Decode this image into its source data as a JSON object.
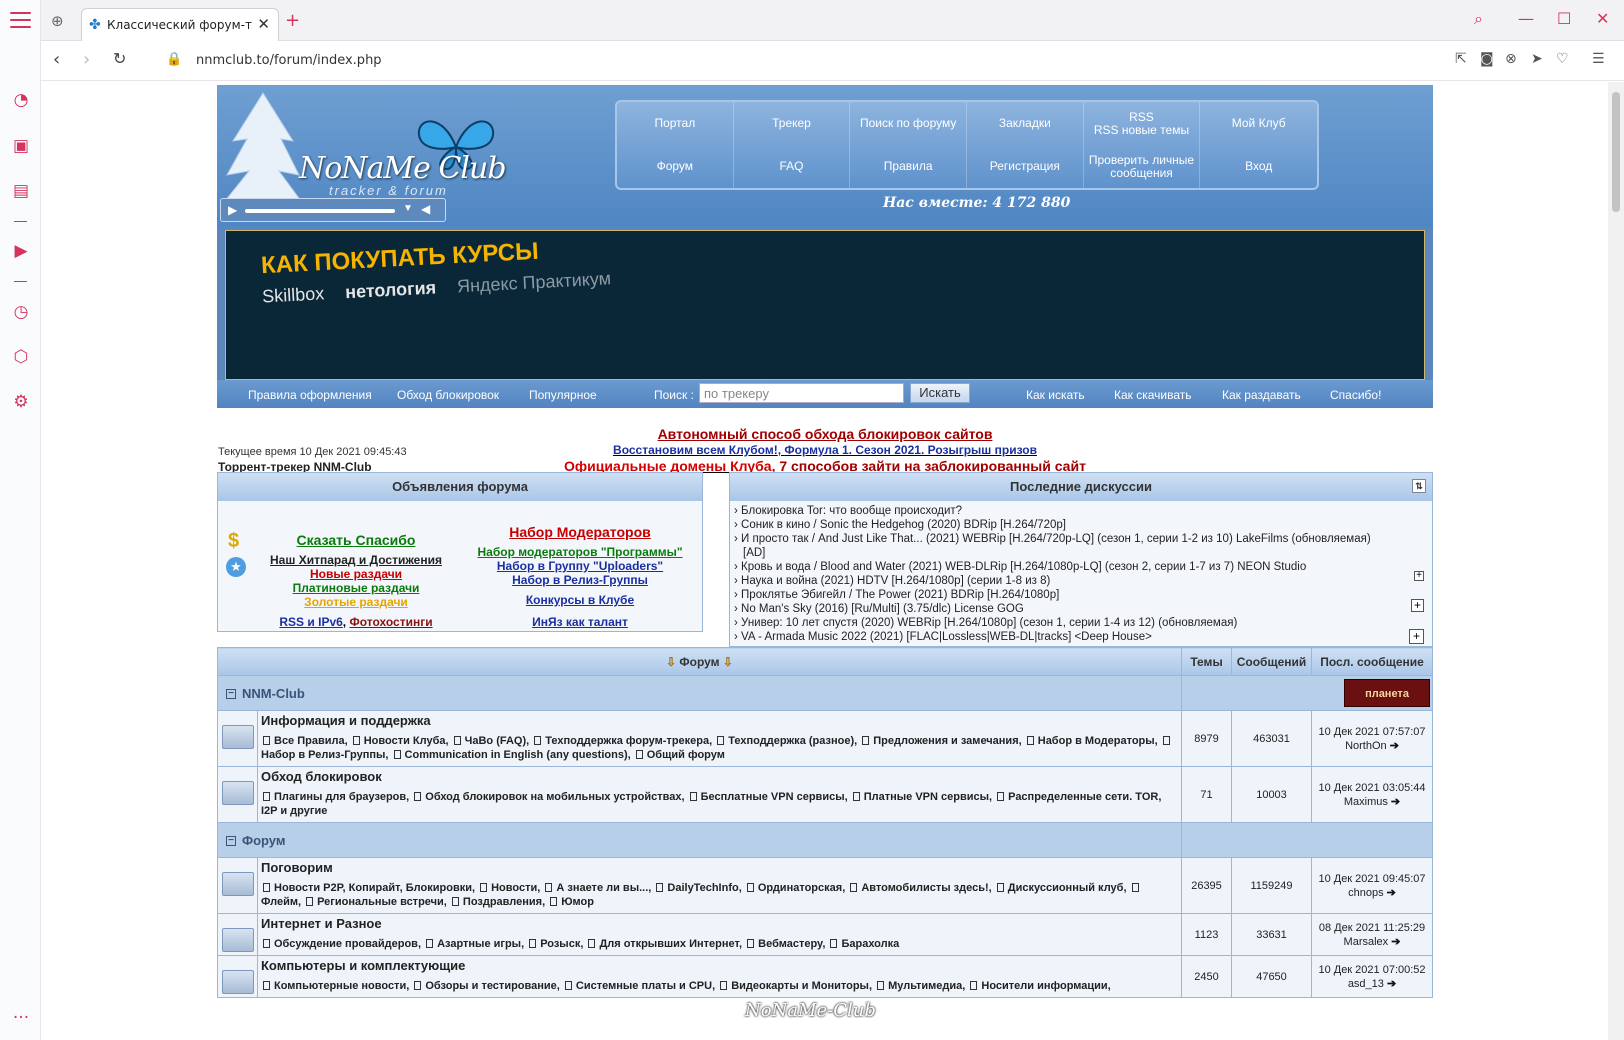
{
  "browser": {
    "tab_title": "Классический форум-трекер",
    "url": "nnmclub.to/forum/index.php"
  },
  "header": {
    "logo": "NoNaMe Club",
    "logo_sub": "tracker & forum",
    "together": "Нас вместе: 4 172 880",
    "nav": [
      "Портал",
      "Трекер",
      "Поиск по форуму",
      "Закладки",
      "RSS\nRSS новые темы",
      "Мой Клуб",
      "Форум",
      "FAQ",
      "Правила",
      "Регистрация",
      "Проверить личные сообщения",
      "Вход"
    ]
  },
  "banner": {
    "headline": "КАК ПОКУПАТЬ КУРСЫ",
    "brands": [
      "Skillbox",
      "нетология",
      "Яндекс Практикум"
    ]
  },
  "toolbar": {
    "left": [
      "Правила оформления",
      "Обход блокировок",
      "Популярное"
    ],
    "search_label": "Поиск :",
    "search_placeholder": "по трекеру",
    "search_button": "Искать",
    "right": [
      "Как искать",
      "Как скачивать",
      "Как раздавать",
      "Спасибо!"
    ]
  },
  "info": {
    "current_time": "Текущее время 10 Дек 2021 09:45:43",
    "tracker_title": "Торрент-трекер NNM-Club",
    "announce_1": "Автономный способ обхода блокировок сайтов",
    "announce_2a": "Восстановим всем Клубом!",
    "announce_2b": "Формула 1. Сезон 2021. Розыгрыш призов",
    "announce_3a": "Официальные домены Клуба",
    "announce_3b": "7 способов зайти на заблокированный сайт"
  },
  "announcements": {
    "title": "Объявления форума",
    "left": [
      {
        "text": "Сказать Спасибо",
        "color": "#0a7a0a",
        "size": 14
      },
      {
        "text": "Наш Хитпарад и Достижения",
        "color": "#222222",
        "size": 12
      },
      {
        "text": "Новые раздачи",
        "color": "#c40000",
        "size": 12
      },
      {
        "text": "Платиновые раздачи",
        "color": "#0a7a0a",
        "size": 12
      },
      {
        "text": "Золотые раздачи",
        "color": "#e6a400",
        "size": 12
      }
    ],
    "left_bottom_a": "RSS и IPv6",
    "left_bottom_b": "Фотохостинги",
    "right": [
      {
        "text": "Набор Модераторов",
        "color": "#c40000",
        "size": 14
      },
      {
        "text": "Набор модераторов \"Программы\"",
        "color": "#0a7a0a",
        "size": 12
      },
      {
        "text": "Набор в Группу \"Uploaders\"",
        "color": "#1a2fa0",
        "size": 12
      },
      {
        "text": "Набор в Релиз-Группы",
        "color": "#1a2fa0",
        "size": 12
      },
      {
        "text": "Конкурсы в Клубе",
        "color": "#1a2fa0",
        "size": 12
      },
      {
        "text": "ИнЯз как талант",
        "color": "#1a2fa0",
        "size": 12
      }
    ]
  },
  "discussions": {
    "title": "Последние дискуссии",
    "items": [
      "Блокировка Tor: что вообще происходит?",
      "Соник в кино / Sonic the Hedgehog (2020) BDRip [H.264/720p]",
      "И просто так / And Just Like That... (2021) WEBRip [H.264/720p-LQ] (сезон 1, серии 1-2 из 10) LakeFilms (обновляемая)",
      "[AD]",
      "Кровь и вода / Blood and Water (2021) WEB-DLRip [H.264/1080p-LQ] (сезон 2, серии 1-7 из 7) NEON Studio",
      "Наука и война (2021) HDTV [H.264/1080p] (серии 1-8 из 8)",
      "Проклятье Эбигейл / The Power (2021) BDRip [H.264/1080p]",
      "No Man's Sky (2016) [Ru/Multi] (3.75/dlc) License GOG",
      "Универ: 10 лет спустя (2020) WEBRip [H.264/1080p] (сезон 1, серии 1-4 из 12) (обновляемая)",
      "VA - Armada Music 2022 (2021) [FLAC|Lossless|WEB-DL|tracks] <Deep House>"
    ]
  },
  "forum": {
    "col_forum": "Форум",
    "col_topics": "Темы",
    "col_posts": "Сообщений",
    "col_last": "Посл. сообщение",
    "planet": "планета",
    "cat1": "NNM-Club",
    "cat2": "Форум",
    "rows": [
      {
        "name": "Информация и поддержка",
        "subs": [
          "Все Правила",
          "Новости Клуба",
          "ЧаВо (FAQ)",
          "Техподдержка форум-трекера",
          "Техподдержка (разное)",
          "Предложения и замечания",
          "Набор в Модераторы",
          "Набор в Релиз-Группы",
          "Communication in English (any questions)",
          "Общий форум"
        ],
        "topics": "8979",
        "posts": "463031",
        "last_date": "10 Дек 2021 07:57:07",
        "last_user": "NorthOn"
      },
      {
        "name": "Обход блокировок",
        "subs": [
          "Плагины для браузеров",
          "Обход блокировок на мобильных устройствах",
          "Бесплатные VPN сервисы",
          "Платные VPN сервисы",
          "Распределенные сети. TOR, I2P и другие"
        ],
        "topics": "71",
        "posts": "10003",
        "last_date": "10 Дек 2021 03:05:44",
        "last_user": "Maximus"
      },
      {
        "name": "Поговорим",
        "subs": [
          "Новости P2P, Копирайт, Блокировки",
          "Новости",
          "А знаете ли вы...",
          "DailyTechInfo",
          "Ординаторская",
          "Автомобилисты здесь!",
          "Дискуссионный клуб",
          "Флейм",
          "Региональные встречи",
          "Поздравления",
          "Юмор"
        ],
        "topics": "26395",
        "posts": "1159249",
        "last_date": "10 Дек 2021 09:45:07",
        "last_user": "chnops"
      },
      {
        "name": "Интернет и Разное",
        "subs": [
          "Обсуждение провайдеров",
          "Азартные игры",
          "Розыск",
          "Для открывших Интернет",
          "Вебмастеру",
          "Барахолка"
        ],
        "topics": "1123",
        "posts": "33631",
        "last_date": "08 Дек 2021 11:25:29",
        "last_user": "Marsalex"
      },
      {
        "name": "Компьютеры и комплектующие",
        "subs": [
          "Компьютерные новости",
          "Обзоры и тестирование",
          "Системные платы и CPU",
          "Видеокарты и Мониторы",
          "Мультимедиа",
          "Носители информации,"
        ],
        "topics": "2450",
        "posts": "47650",
        "last_date": "10 Дек 2021 07:00:52",
        "last_user": "asd_13"
      }
    ]
  },
  "watermark": "NoNaMe-Club"
}
